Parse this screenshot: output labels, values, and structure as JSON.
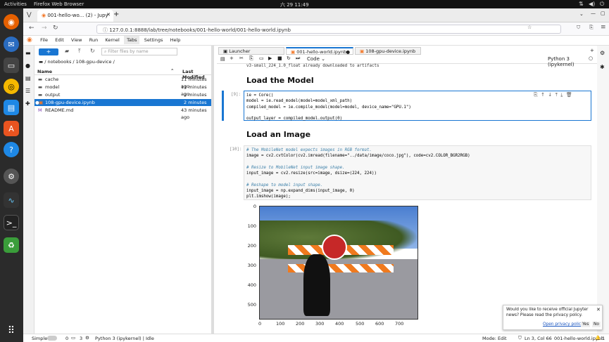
{
  "system": {
    "activities": "Activities",
    "app_name": "Firefox Web Browser",
    "datetime": "六 29  11:49"
  },
  "firefox": {
    "tabs": [
      {
        "label": "001-hello-wo... (2) - Jupy"
      }
    ],
    "new_tab": "+",
    "url": "127.0.0.1:8888/lab/tree/notebooks/001-hello-world/001-hello-world.ipynb"
  },
  "jupyter": {
    "menu": [
      "File",
      "Edit",
      "View",
      "Run",
      "Kernel",
      "Tabs",
      "Settings",
      "Help"
    ],
    "filebrowser": {
      "new_button": "+",
      "filter_placeholder": "Filter files by name",
      "breadcrumb": "/ notebooks / 108-gpu-device /",
      "col_name": "Name",
      "col_modified": "Last Modified",
      "rows": [
        {
          "name": "cache",
          "modified": "11 minutes ago",
          "icon": "folder"
        },
        {
          "name": "model",
          "modified": "11 minutes ago",
          "icon": "folder"
        },
        {
          "name": "output",
          "modified": "2 minutes ago",
          "icon": "folder"
        },
        {
          "name": "108-gpu-device.ipynb",
          "modified": "2 minutes ago",
          "icon": "notebook",
          "selected": true
        },
        {
          "name": "README.md",
          "modified": "43 minutes ago",
          "icon": "markdown"
        }
      ]
    },
    "doc_tabs": [
      {
        "label": "Launcher"
      },
      {
        "label": "001-hello-world.ipynb",
        "active": true
      },
      {
        "label": "108-gpu-device.ipynb"
      }
    ],
    "toolbar": {
      "cell_type": "Code",
      "kernel": "Python 3 (ipykernel)"
    },
    "notebook": {
      "prev_output": "v3-small_224_1.0_float already downloaded to artifacts",
      "heading1": "Load the Model",
      "cell9_prompt": "[9]:",
      "cell9_lines": [
        "ie = Core()",
        "model = ie.read_model(model=model_xml_path)",
        "compiled_model = ie.compile_model(model=model, device_name=\"GPU.1\")",
        "",
        "output_layer = compiled_model.output(0)"
      ],
      "heading2": "Load an Image",
      "cell10_prompt": "[10]:",
      "cell10_lines": [
        "# The MobileNet model expects images in RGB format.",
        "image = cv2.cvtColor(cv2.imread(filename=\"../data/image/coco.jpg\"), code=cv2.COLOR_BGR2RGB)",
        "",
        "# Resize to MobileNet input image shape.",
        "input_image = cv2.resize(src=image, dsize=(224, 224))",
        "",
        "# Reshape to model input shape.",
        "input_image = np.expand_dims(input_image, 0)",
        "plt.imshow(image);"
      ]
    },
    "plot": {
      "y_ticks": [
        "0",
        "100",
        "200",
        "300",
        "400",
        "500"
      ],
      "x_ticks": [
        "0",
        "100",
        "200",
        "300",
        "400",
        "500",
        "600",
        "700"
      ]
    },
    "status": {
      "mode": "Simple",
      "counts_a": "0",
      "counts_b": "3",
      "kernel_status": "Python 3 (ipykernel) | Idle",
      "edit_mode": "Mode: Edit",
      "position": "Ln 3, Col 66",
      "filename": "001-hello-world.ipynb",
      "notifications": "1"
    },
    "toast": {
      "message": "Would you like to receive official Jupyter news? Please read the privacy policy.",
      "link": "Open privacy policy",
      "yes": "Yes",
      "no": "No"
    }
  }
}
